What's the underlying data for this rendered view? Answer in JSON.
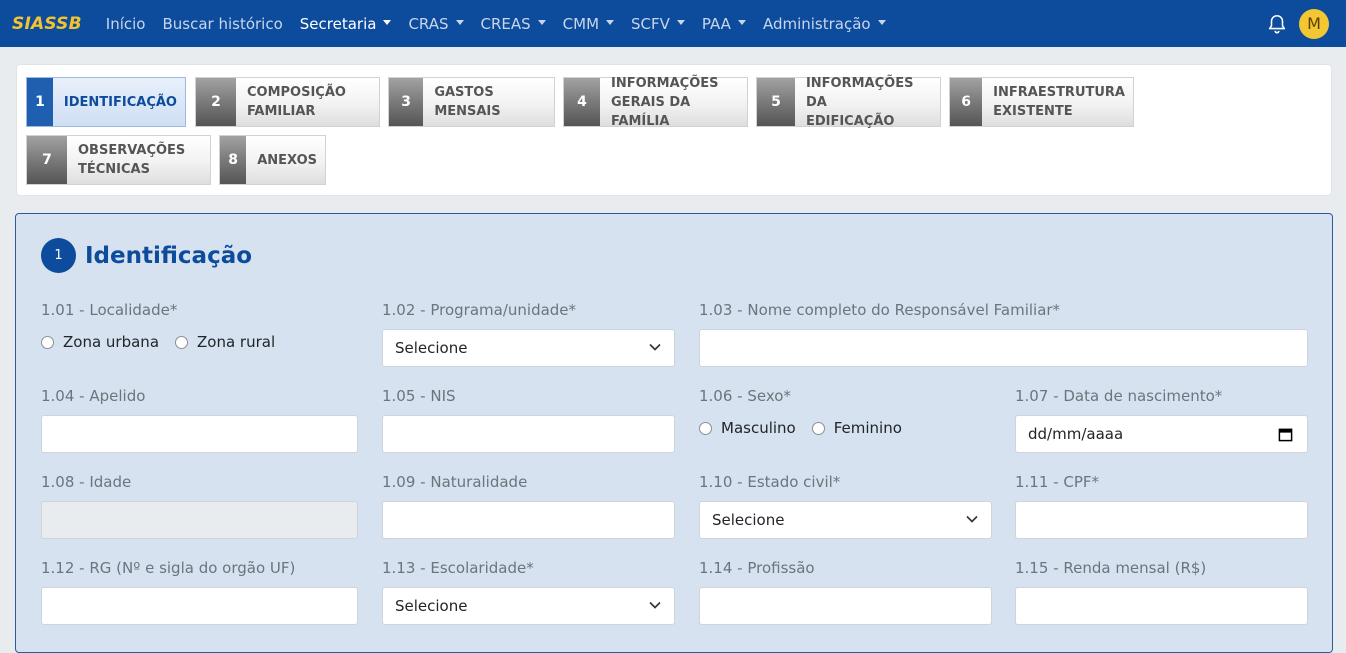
{
  "navbar": {
    "brand": "SIASSB",
    "items": [
      {
        "label": "Início"
      },
      {
        "label": "Buscar histórico"
      },
      {
        "label": "Secretaria"
      },
      {
        "label": "CRAS"
      },
      {
        "label": "CREAS"
      },
      {
        "label": "CMM"
      },
      {
        "label": "SCFV"
      },
      {
        "label": "PAA"
      },
      {
        "label": "Administração"
      }
    ],
    "avatar_initial": "M",
    "colors": {
      "background": "#0d4b9c",
      "brand": "#f4c430",
      "avatar": "#f3c633"
    }
  },
  "steps": [
    {
      "number": "1",
      "line1": "Identificação",
      "line2": ""
    },
    {
      "number": "2",
      "line1": "Composição",
      "line2": "familiar"
    },
    {
      "number": "3",
      "line1": "Gastos mensais",
      "line2": ""
    },
    {
      "number": "4",
      "line1": "Informações",
      "line2": "gerais da família"
    },
    {
      "number": "5",
      "line1": "Informações da",
      "line2": "edificação"
    },
    {
      "number": "6",
      "line1": "Infraestrutura",
      "line2": "existente"
    },
    {
      "number": "7",
      "line1": "Observações",
      "line2": "técnicas"
    },
    {
      "number": "8",
      "line1": "Anexos",
      "line2": ""
    }
  ],
  "section": {
    "number": "1",
    "title": "Identificação"
  },
  "fields": {
    "f101": {
      "label": "1.01 - Localidade*",
      "options": [
        "Zona urbana",
        "Zona rural"
      ]
    },
    "f102": {
      "label": "1.02 - Programa/unidade*",
      "value": "Selecione"
    },
    "f103": {
      "label": "1.03 - Nome completo do Responsável Familiar*",
      "value": ""
    },
    "f104": {
      "label": "1.04 - Apelido",
      "value": ""
    },
    "f105": {
      "label": "1.05 - NIS",
      "value": ""
    },
    "f106": {
      "label": "1.06 - Sexo*",
      "options": [
        "Masculino",
        "Feminino"
      ]
    },
    "f107": {
      "label": "1.07 - Data de nascimento*",
      "value": "dd/mm/aaaa"
    },
    "f108": {
      "label": "1.08 - Idade",
      "value": ""
    },
    "f109": {
      "label": "1.09 - Naturalidade",
      "value": ""
    },
    "f110": {
      "label": "1.10 - Estado civil*",
      "value": "Selecione"
    },
    "f111": {
      "label": "1.11 - CPF*",
      "value": ""
    },
    "f112": {
      "label": "1.12 - RG (Nº e sigla do orgão UF)",
      "value": ""
    },
    "f113": {
      "label": "1.13 - Escolaridade*",
      "value": "Selecione"
    },
    "f114": {
      "label": "1.14 - Profissão",
      "value": ""
    },
    "f115": {
      "label": "1.15 - Renda mensal (R$)",
      "value": ""
    }
  }
}
